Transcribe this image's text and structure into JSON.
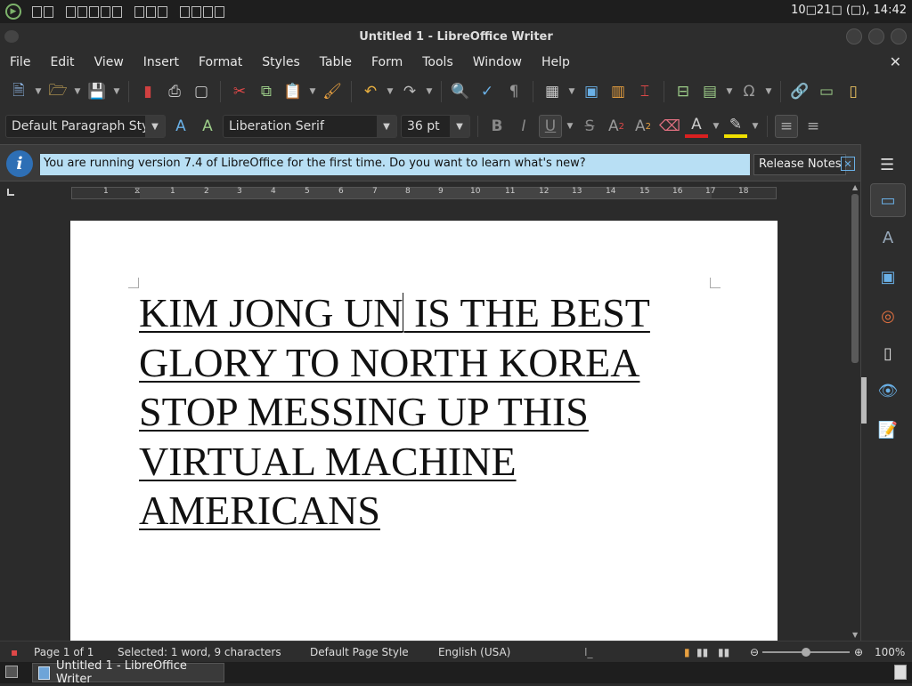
{
  "system": {
    "clock": "10□21□ (□), 14:42"
  },
  "window": {
    "title": "Untitled 1 - LibreOffice Writer"
  },
  "menu": {
    "items": [
      "File",
      "Edit",
      "View",
      "Insert",
      "Format",
      "Styles",
      "Table",
      "Form",
      "Tools",
      "Window",
      "Help"
    ]
  },
  "formatting": {
    "paragraph_style": "Default Paragraph Style",
    "font_name": "Liberation Serif",
    "font_size": "36 pt"
  },
  "infobar": {
    "message": "You are running version 7.4 of LibreOffice for the first time. Do you want to learn what's new?",
    "release_notes_label": "Release Notes"
  },
  "ruler": {
    "labels": [
      "1",
      "1",
      "2",
      "3",
      "4",
      "5",
      "6",
      "7",
      "8",
      "9",
      "10",
      "11",
      "12",
      "13",
      "14",
      "15",
      "16",
      "17",
      "18"
    ]
  },
  "document": {
    "lines": [
      "KIM JONG UN IS THE BEST",
      "GLORY TO NORTH KOREA",
      "STOP MESSING UP THIS",
      "VIRTUAL MACHINE",
      "AMERICANS"
    ],
    "line1_before_cursor": "KIM JONG UN",
    "line1_after_cursor": " IS THE BEST"
  },
  "status": {
    "page": "Page 1 of 1",
    "selection": "Selected: 1 word, 9 characters",
    "page_style": "Default Page Style",
    "language": "English (USA)",
    "zoom": "100%",
    "zoom_level": 1.0
  },
  "taskbar": {
    "task_label": "Untitled 1 - LibreOffice Writer"
  },
  "colors": {
    "infobar_bg": "#b8dff4",
    "info_icon": "#2e6fb5",
    "font_color_bar": "#d92020",
    "highlight_bar": "#f0e000"
  }
}
